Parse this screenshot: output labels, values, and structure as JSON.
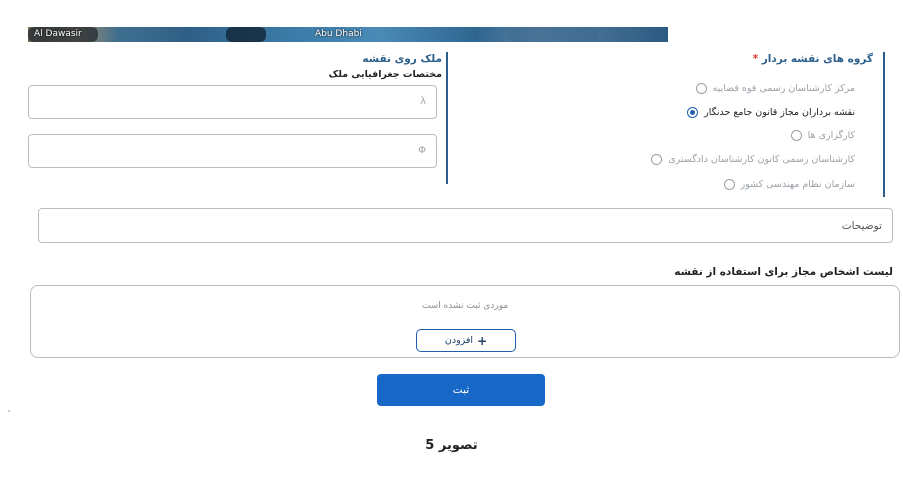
{
  "map": {
    "labels": [
      "Al Dawasir",
      "Abu Dhabi"
    ]
  },
  "mapper_group": {
    "title": "گروه های نقشه بردار",
    "required_mark": "*",
    "options": [
      {
        "label": "مرکز کارشناسان رسمی قوه قضاییه",
        "selected": false
      },
      {
        "label": "نقشه برداران مجاز قانون جامع حدنگار",
        "selected": true
      },
      {
        "label": "کارگزاری ها",
        "selected": false
      },
      {
        "label": "کارشناسان رسمی کانون کارشناسان دادگستری",
        "selected": false
      },
      {
        "label": "سازمان نظام مهندسی کشور",
        "selected": false
      }
    ]
  },
  "property_panel": {
    "title": "ملک روی نقشه",
    "subtitle": "مختصات جغرافیایی ملک",
    "longitude_symbol": "λ",
    "latitude_symbol": "Φ",
    "longitude_value": "",
    "latitude_value": ""
  },
  "description": {
    "placeholder": "توضیحات"
  },
  "authorized_list": {
    "title": "لیست اشخاص مجاز برای استفاده از نقشه",
    "empty_text": "موردی ثبت نشده است",
    "add_label": "افزودن",
    "add_icon": "+"
  },
  "submit": {
    "label": "ثبت"
  },
  "caption": "تصویر 5"
}
